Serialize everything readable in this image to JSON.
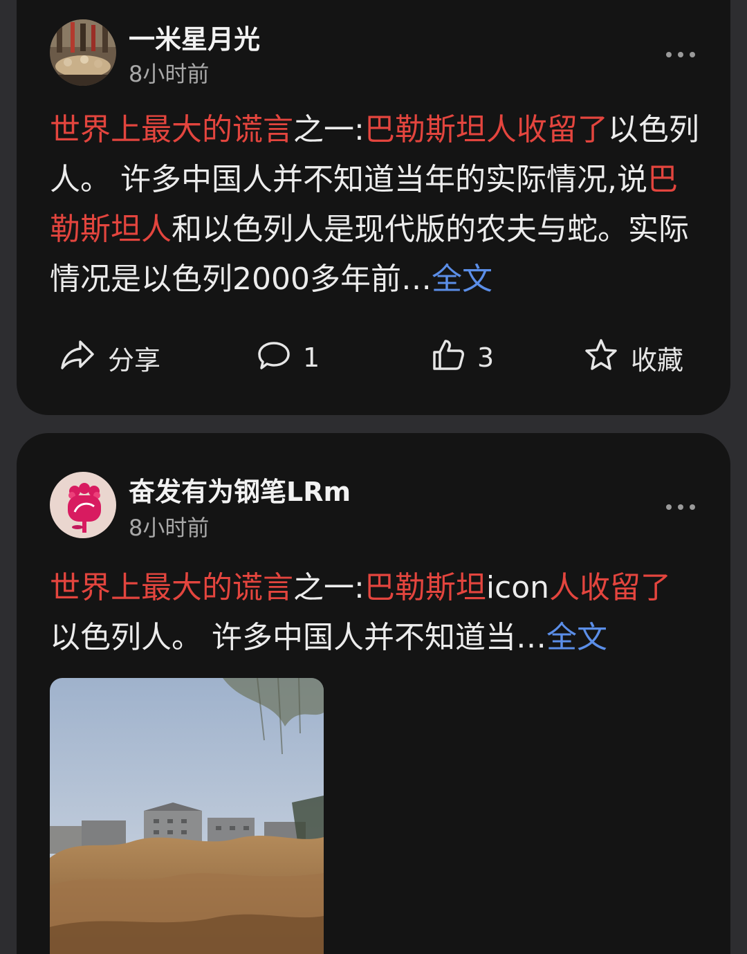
{
  "posts": [
    {
      "author": "一米星月光",
      "time": "8小时前",
      "text": {
        "h1": "世界上最大的谎言",
        "t1": "之一:",
        "h2": "巴勒斯坦人收留了",
        "t2": "以色列人。 许多中国人并不知道当年的实际情况,说",
        "h3": "巴勒斯坦人",
        "t3": "和以色列人是现代版的农夫与蛇。实际情况是以色列2000多年前",
        "ellipsis": "…",
        "full": "全文"
      },
      "actions": {
        "share_label": "分享",
        "comment_count": "1",
        "like_count": "3",
        "favorite_label": "收藏"
      }
    },
    {
      "author": "奋发有为钢笔LRm",
      "time": "8小时前",
      "text": {
        "h1": "世界上最大的谎言",
        "t1": "之一:",
        "h2": "巴勒斯坦",
        "t2": "icon",
        "h3": "人收留了",
        "t3": "以色列人。 许多中国人并不知道当",
        "ellipsis": "…",
        "full": "全文"
      }
    }
  ],
  "colors": {
    "background": "#2d2d30",
    "card": "#141414",
    "highlight": "#e3453e",
    "link": "#5b8ee8"
  },
  "icons": [
    "more-icon",
    "share-icon",
    "comment-icon",
    "like-icon",
    "favorite-icon"
  ]
}
